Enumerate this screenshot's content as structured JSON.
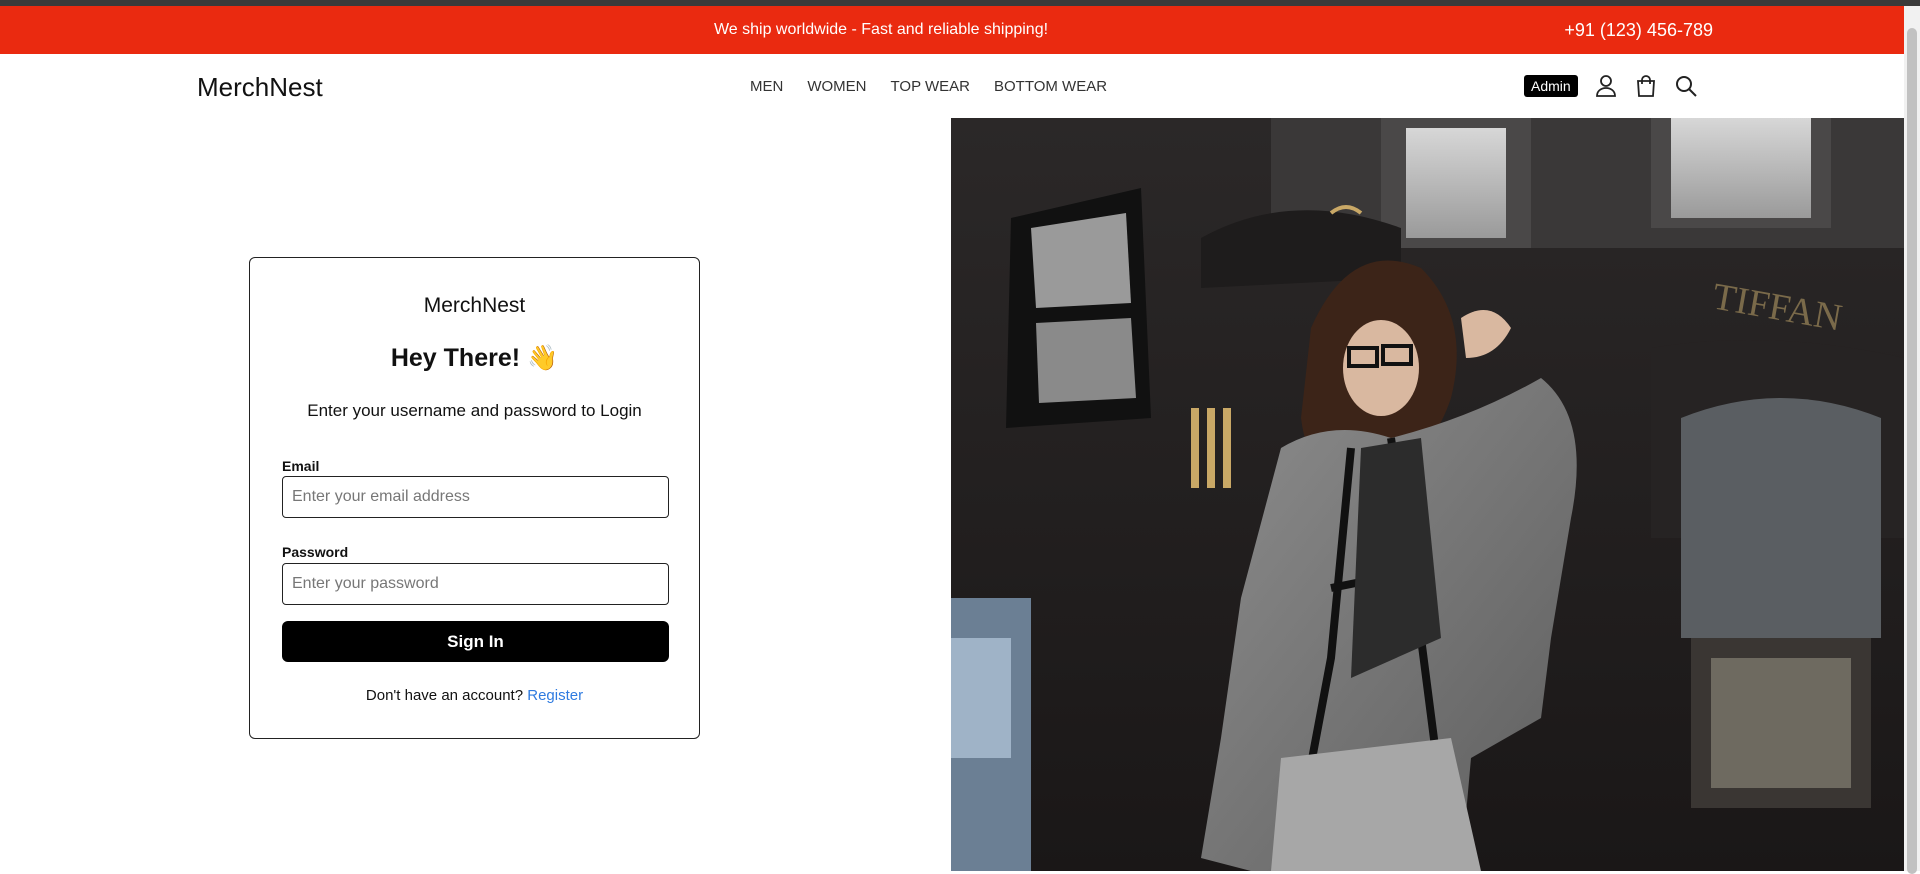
{
  "banner": {
    "message": "We ship worldwide - Fast and reliable shipping!",
    "phone": "+91 (123) 456-789"
  },
  "header": {
    "logo": "MerchNest",
    "nav": [
      "MEN",
      "WOMEN",
      "TOP WEAR",
      "BOTTOM WEAR"
    ],
    "admin_label": "Admin",
    "icons": [
      "user-icon",
      "shopping-bag-icon",
      "search-icon"
    ]
  },
  "login": {
    "brand": "MerchNest",
    "title": "Hey There!",
    "title_emoji": "👋",
    "subtitle": "Enter your username and password to Login",
    "email_label": "Email",
    "email_placeholder": "Enter your email address",
    "email_value": "",
    "password_label": "Password",
    "password_placeholder": "Enter your password",
    "password_value": "",
    "submit_label": "Sign In",
    "register_prompt": "Don't have an account?",
    "register_link": "Register"
  },
  "colors": {
    "banner": "#ea2a10",
    "button": "#000000",
    "link": "#2f7be0"
  }
}
